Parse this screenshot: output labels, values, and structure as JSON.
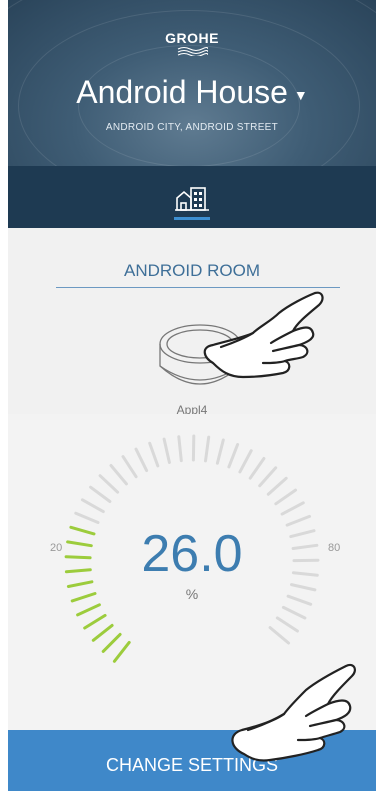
{
  "header": {
    "brand": "GROHE",
    "house_name": "Android House",
    "address": "ANDROID CITY, ANDROID STREET",
    "tab_icon": "building-icon",
    "bg_color": "#3f5d75",
    "tab_color": "#1e3a52",
    "accent": "#3d8fd1"
  },
  "room": {
    "name": "ANDROID ROOM",
    "device_label": "Appl4",
    "device_icon": "sense-sensor-icon"
  },
  "gauge": {
    "value": "26.0",
    "unit": "%",
    "min_label": "20",
    "max_label": "80",
    "min": 20,
    "max": 80,
    "current": 26.0,
    "active_color": "#9ccc3c",
    "inactive_color": "#d9d9d9",
    "value_color": "#3d7db0"
  },
  "action": {
    "label": "CHANGE SETTINGS",
    "color": "#3f88c9"
  },
  "annotations": {
    "hand_icon": "pointing-hand-icon"
  }
}
